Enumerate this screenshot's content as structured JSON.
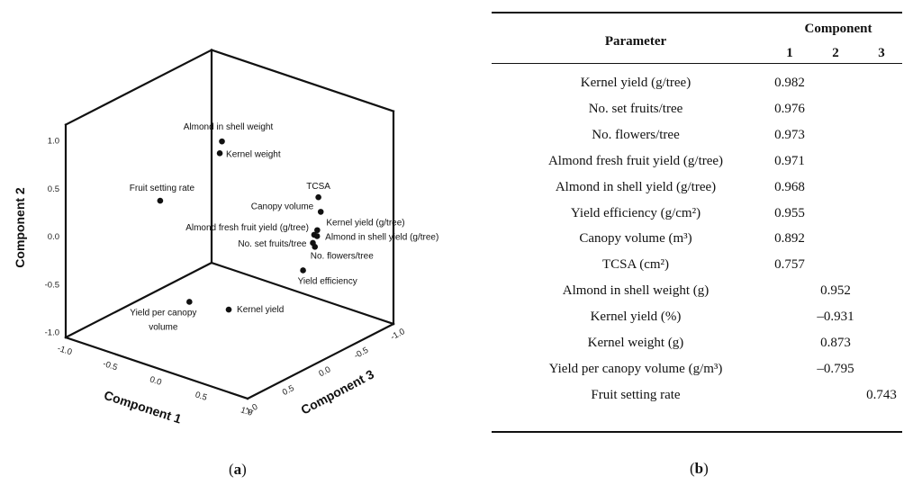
{
  "chart_data": {
    "type": "scatter",
    "projection": "3d",
    "axes": {
      "x": {
        "label": "Component 1",
        "ticks": [
          "-1.0",
          "-0.5",
          "0.0",
          "0.5",
          "1.0"
        ],
        "range": [
          -1,
          1
        ]
      },
      "y": {
        "label": "Component 2",
        "ticks": [
          "-1.0",
          "-0.5",
          "0.0",
          "0.5",
          "1.0"
        ],
        "range": [
          -1,
          1
        ]
      },
      "z": {
        "label": "Component 3",
        "ticks": [
          "-1.0",
          "-0.5",
          "0.0",
          "0.5",
          "1.0"
        ],
        "range": [
          -1,
          1
        ]
      }
    },
    "grid": false,
    "points": [
      {
        "label": [
          "Almond in shell weight"
        ],
        "c1": -0.02,
        "c2": 0.95,
        "c3": 0.08
      },
      {
        "label": [
          "Kernel weight"
        ],
        "c1": 0.02,
        "c2": 0.87,
        "c3": 0.16
      },
      {
        "label": [
          "Fruit setting rate"
        ],
        "c1": -0.17,
        "c2": 0.54,
        "c3": 0.74
      },
      {
        "label": [
          "TCSA"
        ],
        "c1": 0.76,
        "c2": 0.48,
        "c3": -0.27
      },
      {
        "label": [
          "Canopy volume"
        ],
        "c1": 0.89,
        "c2": 0.42,
        "c3": -0.14
      },
      {
        "label": [
          "Kernel yield  (g/tree)"
        ],
        "c1": 0.98,
        "c2": 0.32,
        "c3": 0.02
      },
      {
        "label": [
          "Almond fresh fruit yield (g/tree)"
        ],
        "c1": 0.97,
        "c2": 0.28,
        "c3": 0.05
      },
      {
        "label": [
          "Almond in shell yield (g/tree)"
        ],
        "c1": 0.97,
        "c2": 0.25,
        "c3": 0.01
      },
      {
        "label": [
          "No. set fruits/tree"
        ],
        "c1": 0.98,
        "c2": 0.21,
        "c3": 0.08
      },
      {
        "label": [
          "No. flowers/tree"
        ],
        "c1": 0.97,
        "c2": 0.15,
        "c3": 0.04
      },
      {
        "label": [
          "Yield efficiency"
        ],
        "c1": 0.96,
        "c2": -0.04,
        "c3": 0.19
      },
      {
        "label": [
          "Yield per canopy",
          "volume"
        ],
        "c1": -0.33,
        "c2": -0.8,
        "c3": 0.14
      },
      {
        "label": [
          "Kernel yield"
        ],
        "c1": -0.13,
        "c2": -0.93,
        "c3": -0.15
      }
    ]
  },
  "captions": {
    "a": "a",
    "b": "b"
  },
  "table": {
    "header": {
      "parameter": "Parameter",
      "component": "Component",
      "columns": [
        "1",
        "2",
        "3"
      ]
    },
    "rows": [
      {
        "parameter": "Kernel yield (g/tree)",
        "values": [
          "0.982",
          "",
          ""
        ]
      },
      {
        "parameter": "No. set fruits/tree",
        "values": [
          "0.976",
          "",
          ""
        ]
      },
      {
        "parameter": "No. flowers/tree",
        "values": [
          "0.973",
          "",
          ""
        ]
      },
      {
        "parameter": "Almond fresh fruit yield (g/tree)",
        "values": [
          "0.971",
          "",
          ""
        ]
      },
      {
        "parameter": "Almond in shell yield (g/tree)",
        "values": [
          "0.968",
          "",
          ""
        ]
      },
      {
        "parameter": "Yield efficiency (g/cm²)",
        "values": [
          "0.955",
          "",
          ""
        ]
      },
      {
        "parameter": "Canopy volume (m³)",
        "values": [
          "0.892",
          "",
          ""
        ]
      },
      {
        "parameter": "TCSA (cm²)",
        "values": [
          "0.757",
          "",
          ""
        ]
      },
      {
        "parameter": "Almond in shell weight (g)",
        "values": [
          "",
          "0.952",
          ""
        ]
      },
      {
        "parameter": "Kernel yield (%)",
        "values": [
          "",
          "–0.931",
          ""
        ]
      },
      {
        "parameter": "Kernel weight (g)",
        "values": [
          "",
          "0.873",
          ""
        ]
      },
      {
        "parameter": "Yield per canopy volume (g/m³)",
        "values": [
          "",
          "–0.795",
          ""
        ]
      },
      {
        "parameter": "Fruit setting rate",
        "values": [
          "",
          "",
          "0.743"
        ]
      }
    ]
  }
}
